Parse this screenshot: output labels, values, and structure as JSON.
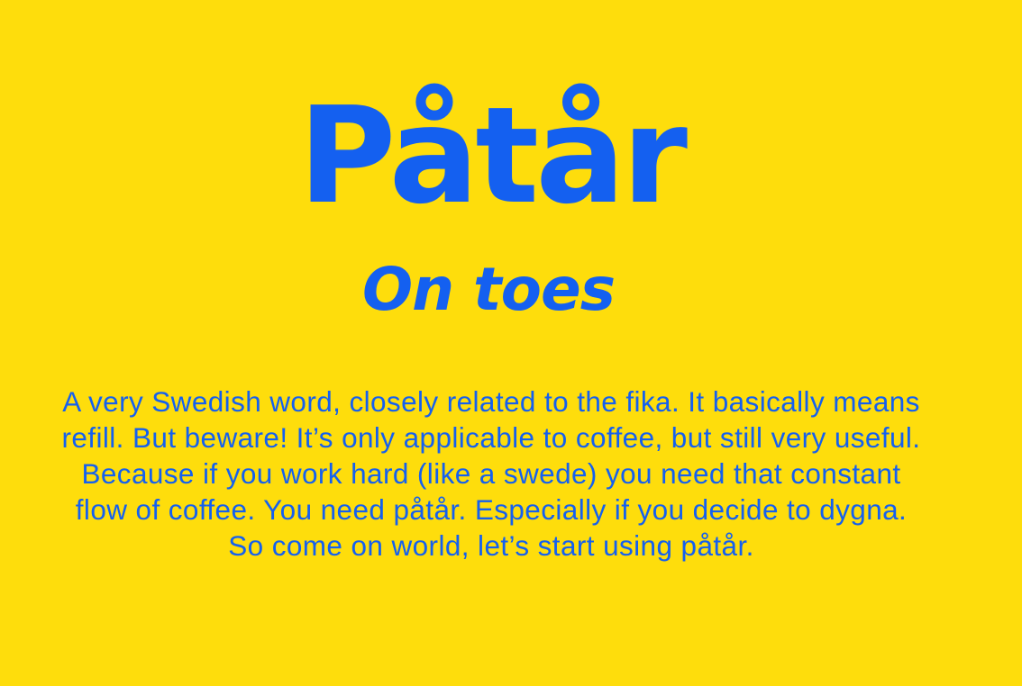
{
  "card": {
    "word": "Påtår",
    "translation": "On toes",
    "description": "A very Swedish word, closely related to the fika. It basically means refill. But beware! It’s only applicable to coffee, but still very useful. Because if you work hard (like a swede) you need that constant flow of coffee. You need påtår. Especially if you decide to dygna. So come on world, let’s start using påtår."
  },
  "colors": {
    "background": "#FEDD0C",
    "text": "#1460F0"
  }
}
